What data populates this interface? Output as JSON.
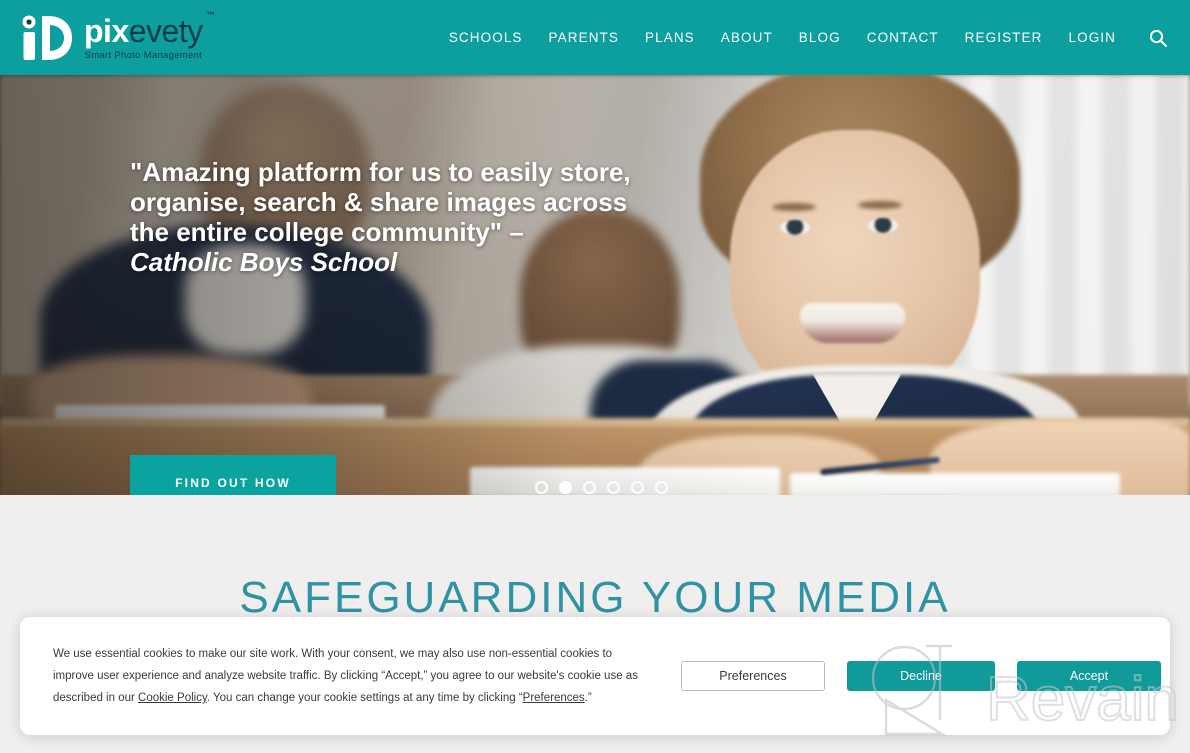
{
  "brand": {
    "logo_mark": "id-monogram-logo",
    "name_part1": "pix",
    "name_part2": "evety",
    "trademark": "™",
    "tagline": "Smart Photo Management",
    "accent_color": "#0d9e9e",
    "dark_color": "#0b3d4a"
  },
  "header": {
    "nav": [
      {
        "label": "SCHOOLS"
      },
      {
        "label": "PARENTS"
      },
      {
        "label": "PLANS"
      },
      {
        "label": "ABOUT"
      },
      {
        "label": "BLOG"
      },
      {
        "label": "CONTACT"
      },
      {
        "label": "REGISTER"
      },
      {
        "label": "LOGIN"
      }
    ],
    "search_icon": "search-icon"
  },
  "hero": {
    "quote_line1": "\"Amazing platform for us to easily store,",
    "quote_line2": "organise, search & share images across",
    "quote_line3": "the entire college community\" –",
    "attribution": "Catholic Boys School",
    "cta_label": "FIND OUT HOW",
    "cta_color": "#0ba3a0",
    "carousel": {
      "total": 6,
      "active_index": 1
    },
    "scroll_hint_icon": "chevron-down-icon",
    "scroll_hint_color": "#2fb3a8"
  },
  "section": {
    "title": "SAFEGUARDING YOUR MEDIA",
    "title_color": "#2e93a4",
    "background": "#f0efee"
  },
  "cookie_banner": {
    "text_part1": "We use essential cookies to make our site work. With your consent, we may also use non-essential cookies to improve user experience and analyze website traffic. By clicking “Accept,” you agree to our website's cookie use as described in our ",
    "link_policy": "Cookie Policy",
    "text_part2": ". You can change your cookie settings at any time by clicking “",
    "link_preferences": "Preferences",
    "text_part3": ".”",
    "buttons": {
      "preferences": "Preferences",
      "decline": "Decline",
      "accept": "Accept"
    },
    "button_color": "#109a9a"
  },
  "watermark": {
    "text": "Revain",
    "logo": "revain-outline-logo"
  }
}
